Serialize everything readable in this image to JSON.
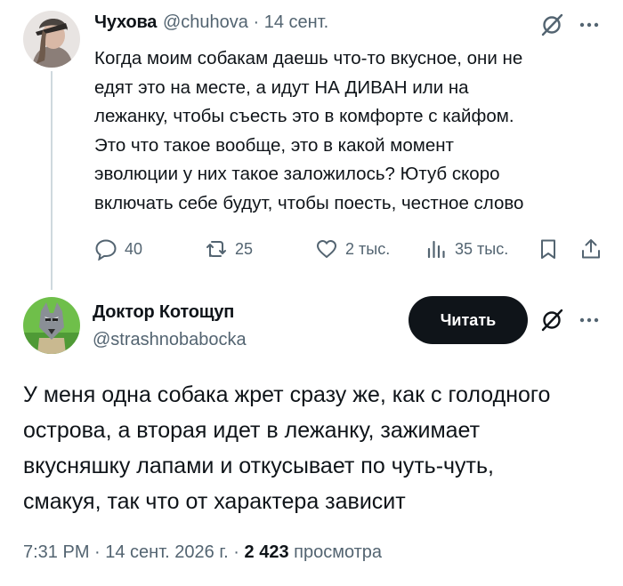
{
  "tweet1": {
    "author_name": "Чухова",
    "handle_time": "@chuhova · 14 сент.",
    "text_lines": [
      "Когда моим собакам даешь что-то вкусное, они не",
      "едят это на месте, а идут НА ДИВАН или на",
      "лежанку, чтобы съесть это в комфорте с кайфом.",
      "Это что такое вообще, это в какой момент",
      "эволюции у них такое заложилось? Ютуб скоро",
      "включать себе будут, чтобы поесть, честное слово"
    ],
    "replies": "40",
    "reposts": "25",
    "likes": "2 тыс.",
    "views": "35 тыс."
  },
  "tweet2": {
    "author_name": "Доктор Котощуп",
    "handle": "@strashnobabocka",
    "read_button": "Читать",
    "text_lines": [
      "У меня одна собака жрет сразу же, как с голодного",
      "острова, а вторая идет в лежанку, зажимает",
      "вкусняшку лапами и откусывает по чуть-чуть,",
      "смакуя, так что от характера зависит"
    ],
    "time_date": "7:31 PM · 14 сент. 2026 г. · ",
    "views_count": "2 423",
    "views_label": " просмотра"
  },
  "colors": {
    "text": "#0f1419",
    "secondary": "#536471",
    "thread_line": "#cfd9de",
    "button_bg": "#0f1419"
  },
  "icons": [
    "grok-icon",
    "more-icon",
    "reply-icon",
    "repost-icon",
    "like-icon",
    "views-icon",
    "bookmark-icon",
    "share-icon"
  ]
}
